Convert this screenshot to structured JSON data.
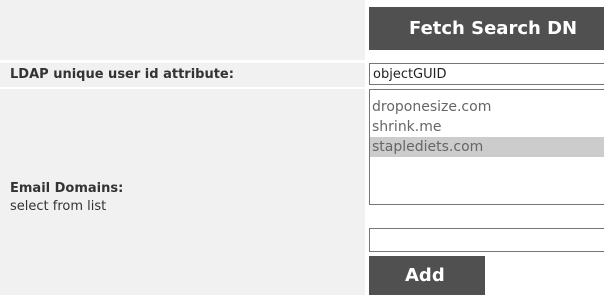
{
  "fetch": {
    "button_label": "Fetch Search DN"
  },
  "ldap": {
    "label": "LDAP unique user id attribute:",
    "value": "objectGUID"
  },
  "email_domains": {
    "label": "Email Domains:",
    "sublabel": "select from list",
    "items": [
      {
        "label": "droponesize.com",
        "selected": false
      },
      {
        "label": "shrink.me",
        "selected": false
      },
      {
        "label": "staplediets.com",
        "selected": true
      }
    ],
    "new_domain_value": "",
    "add_label": "Add"
  }
}
